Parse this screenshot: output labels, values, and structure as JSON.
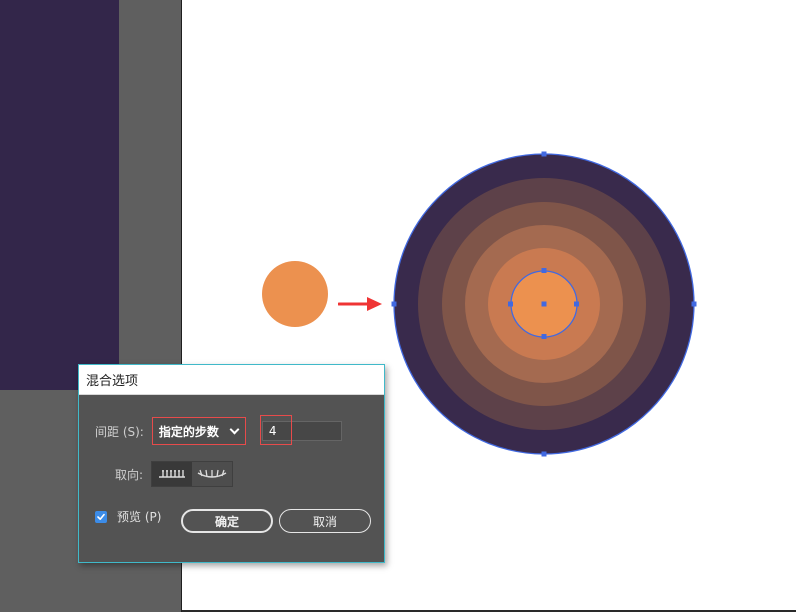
{
  "dialog": {
    "title": "混合选项",
    "spacing_label": "间距 (S):",
    "spacing_option": "指定的步数",
    "steps_value": "4",
    "orientation_label": "取向:",
    "preview_label": "预览 (P)",
    "preview_checked": true,
    "ok_label": "确定",
    "cancel_label": "取消"
  },
  "colors": {
    "accent_red": "#e74b4b",
    "dialog_border": "#40b9c9",
    "small_circle": "#ec914f",
    "outer_circle": "#392a4c",
    "selection_blue": "#4169e1"
  },
  "icons": {
    "align_page": "orientation-align-page-icon",
    "align_path": "orientation-align-path-icon",
    "arrow": "arrow-right-icon",
    "checkbox": "checkbox-checked-icon"
  }
}
